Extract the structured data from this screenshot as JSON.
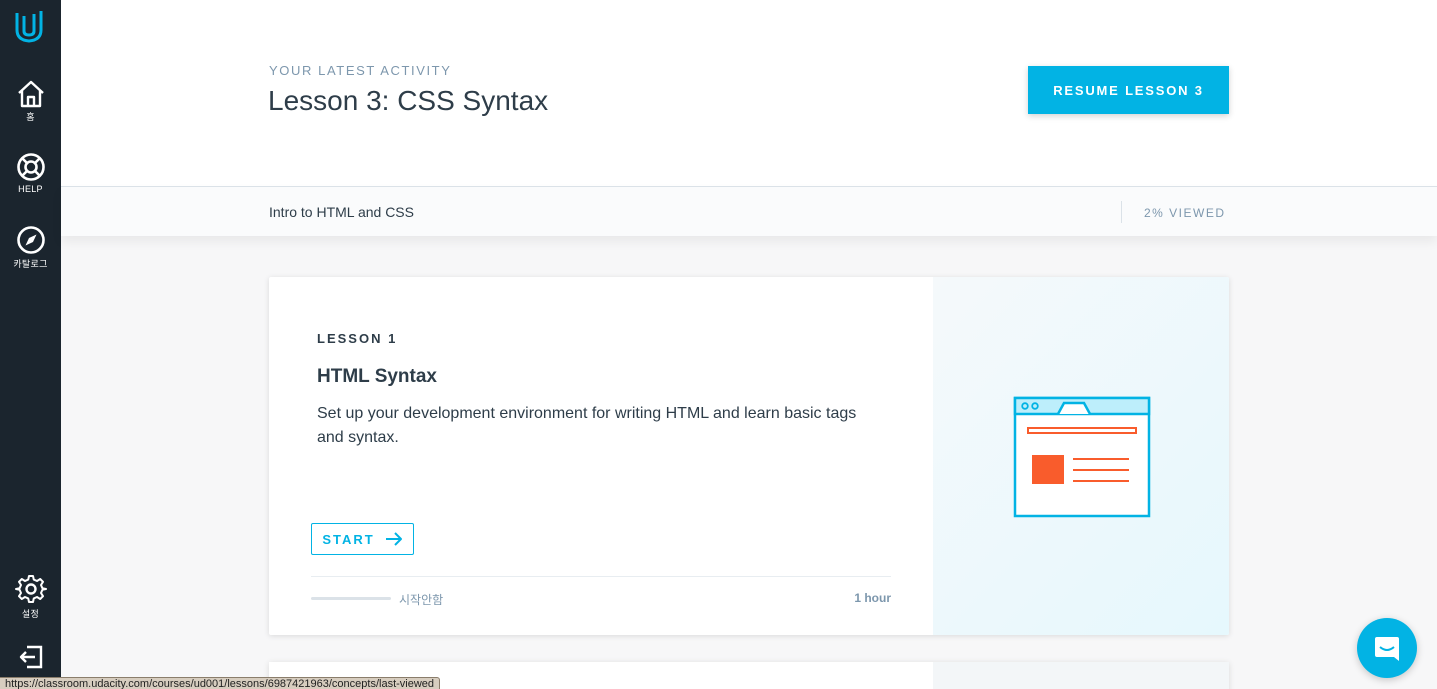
{
  "sidebar": {
    "items": [
      {
        "label": "홈",
        "icon": "home-icon"
      },
      {
        "label": "HELP",
        "icon": "lifebuoy-icon"
      },
      {
        "label": "카탈로그",
        "icon": "compass-icon"
      },
      {
        "label": "설정",
        "icon": "gear-icon"
      }
    ],
    "logout_icon": "logout-icon"
  },
  "header": {
    "eyebrow": "YOUR LATEST ACTIVITY",
    "title": "Lesson 3: CSS Syntax",
    "resume_label": "RESUME LESSON 3"
  },
  "course_bar": {
    "course_name": "Intro to HTML and CSS",
    "progress_text": "2% VIEWED"
  },
  "lessons": [
    {
      "eyebrow": "LESSON 1",
      "title": "HTML Syntax",
      "description": "Set up your development environment for writing HTML and learn basic tags and syntax.",
      "start_label": "START",
      "status": "시작안함",
      "duration": "1 hour",
      "progress_fraction": 0
    }
  ],
  "status_bar": {
    "url": "https://classroom.udacity.com/courses/ud001/lessons/6987421963/concepts/last-viewed"
  },
  "colors": {
    "accent": "#02b3e4",
    "sidebar": "#1b252e",
    "illustration_orange": "#f95c2c"
  }
}
